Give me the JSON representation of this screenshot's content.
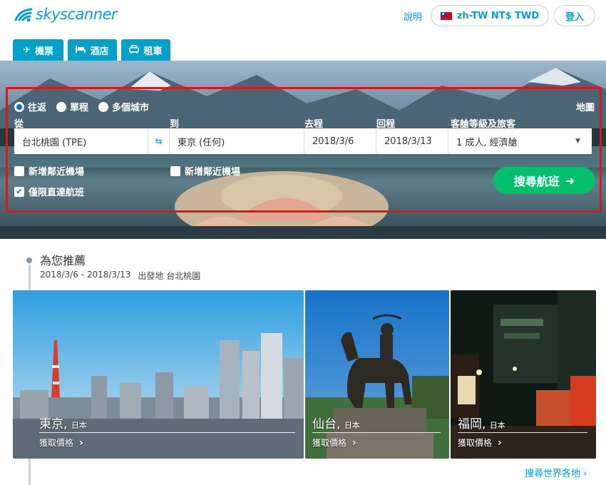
{
  "header": {
    "logo_text": "skyscanner",
    "help_label": "說明",
    "locale_label": "zh-TW NT$ TWD",
    "login_label": "登入"
  },
  "tabs": [
    {
      "label": "機票",
      "icon": "plane-icon",
      "active": true
    },
    {
      "label": "酒店",
      "icon": "bed-icon",
      "active": false
    },
    {
      "label": "租車",
      "icon": "car-icon",
      "active": false
    }
  ],
  "search": {
    "trip_types": [
      {
        "label": "往返",
        "selected": true
      },
      {
        "label": "單程",
        "selected": false
      },
      {
        "label": "多個城市",
        "selected": false
      }
    ],
    "map_label": "地圖",
    "from_label": "從",
    "from_value": "台北桃園 (TPE)",
    "to_label": "到",
    "to_value": "東京 (任何)",
    "depart_label": "去程",
    "depart_value": "2018/3/6",
    "return_label": "回程",
    "return_value": "2018/3/13",
    "cabin_label": "客艙等級及旅客",
    "cabin_value": "1 成人, 經濟艙",
    "nearby_from_label": "新增鄰近機場",
    "nearby_to_label": "新增鄰近機場",
    "direct_label": "僅限直達航班",
    "direct_checked": true,
    "search_button_label": "搜尋航班"
  },
  "recommendations": {
    "title": "為您推薦",
    "dates": "2018/3/6 - 2018/3/13",
    "origin": "出發地 台北桃園",
    "cards": [
      {
        "city": "東京",
        "country": "日本",
        "price_label": "獲取價格"
      },
      {
        "city": "仙台",
        "country": "日本",
        "price_label": "獲取價格"
      },
      {
        "city": "福岡",
        "country": "日本",
        "price_label": "獲取價格"
      }
    ],
    "explore_label": "搜尋世界各地 ›"
  },
  "colors": {
    "brand": "#00a2d6",
    "tab": "#00a2c9",
    "search_button": "#00c16b",
    "highlight_border": "#e0141b"
  }
}
